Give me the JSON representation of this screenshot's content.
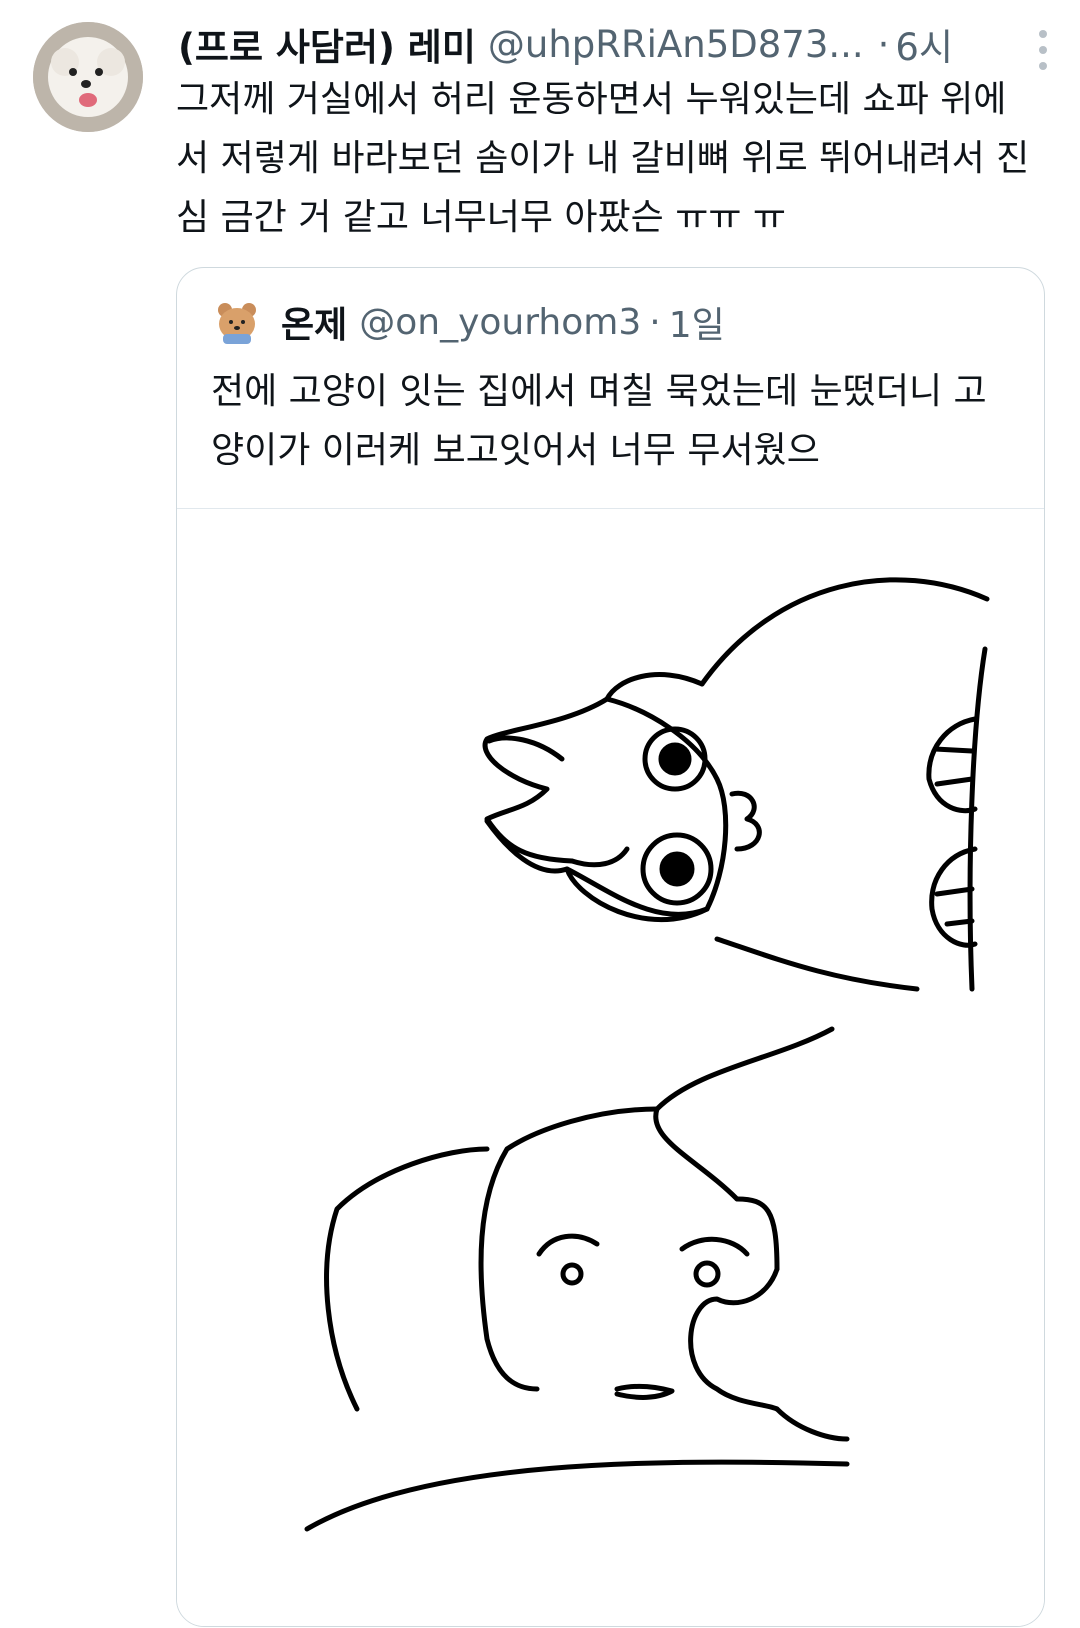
{
  "tweet": {
    "author_name": "(프로 사담러) 레미",
    "author_handle": "@uhpRRiAn5D873...",
    "separator": "·",
    "time": "6시",
    "text": "그저께 거실에서 허리 운동하면서 누워있는데 쇼파 위에서 저렇게 바라보던 솜이가 내 갈비뼈 위로 뛰어내려서 진심 금간 거 같고 너무너무 아팠슨 ㅠㅠ ㅠ"
  },
  "quoted_tweet": {
    "author_name": "온제",
    "author_handle": "@on_yourhom3",
    "separator": "·",
    "time": "1일",
    "text": "전에 고양이 잇는 집에서 며칠 묵었는데 눈떴더니 고양이가 이러케 보고잇어서 너무 무서웠으"
  },
  "icons": {
    "more": "more-vertical-icon"
  }
}
